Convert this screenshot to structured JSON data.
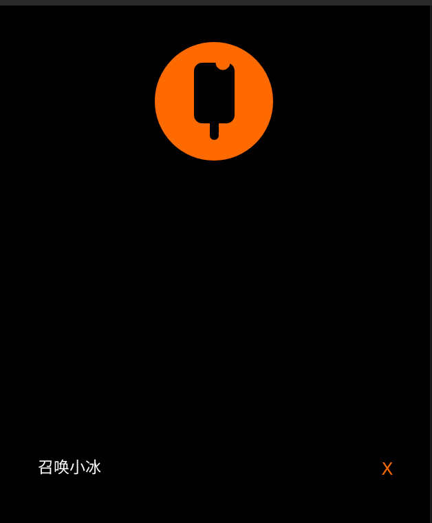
{
  "logo": {
    "icon": "popsicle-icon",
    "background_color": "#ff6a00",
    "icon_color": "#000000"
  },
  "footer": {
    "summon_label": "召唤小冰",
    "close_label": "X",
    "close_color": "#ff6a00",
    "label_color": "#ffffff"
  },
  "theme": {
    "background": "#000000"
  }
}
